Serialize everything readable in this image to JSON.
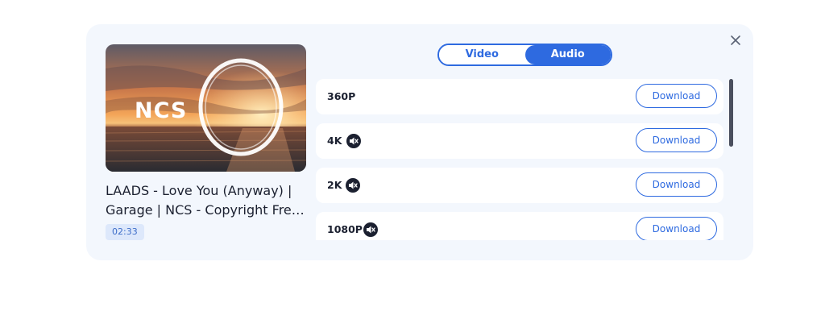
{
  "video": {
    "title": "LAADS - Love You (Anyway) | Garage | NCS - Copyright Fre…",
    "duration": "02:33",
    "thumbnail_logo_text": "NCS"
  },
  "tabs": [
    {
      "label": "Video",
      "active": false
    },
    {
      "label": "Audio",
      "active": true
    }
  ],
  "formats": [
    {
      "quality": "360P",
      "muted": false,
      "button": "Download"
    },
    {
      "quality": "4K",
      "muted": true,
      "button": "Download"
    },
    {
      "quality": "2K",
      "muted": true,
      "button": "Download"
    },
    {
      "quality": "1080P",
      "muted": true,
      "button": "Download"
    }
  ],
  "icons": {
    "close": "close-icon",
    "mute": "speaker-mute-icon"
  },
  "colors": {
    "accent": "#2e6ae0",
    "card_bg": "#f3f7fd",
    "duration_bg": "#dde8fb"
  }
}
